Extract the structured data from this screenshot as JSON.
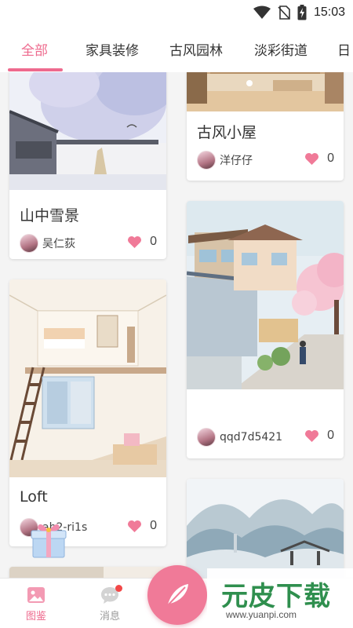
{
  "status_bar": {
    "time": "15:03",
    "icons": [
      "wifi-icon",
      "no-sim-icon",
      "battery-charging-icon"
    ]
  },
  "tabs": [
    {
      "label": "全部",
      "active": true
    },
    {
      "label": "家具装修",
      "active": false
    },
    {
      "label": "古风园林",
      "active": false
    },
    {
      "label": "淡彩街道",
      "active": false
    },
    {
      "label": "日",
      "active": false
    }
  ],
  "feed": {
    "cards": [
      {
        "title": "山中雪景",
        "author": "吴仁荻",
        "likes": "0",
        "image": "snowy-mountain-courtyard-illustration"
      },
      {
        "title": "古风小屋",
        "author": "洋仔仔",
        "likes": "0",
        "image": "wooden-room-interior-illustration"
      },
      {
        "title": "Loft",
        "author": "ah2-ri1s",
        "likes": "0",
        "image": "loft-interior-illustration"
      },
      {
        "title": "",
        "author": "qqd7d5421",
        "likes": "0",
        "image": "cherry-blossom-street-illustration"
      },
      {
        "title": "",
        "author": "",
        "likes": "",
        "image": "misty-mountain-pavilion-illustration"
      }
    ]
  },
  "bottom_nav": {
    "items": [
      {
        "label": "图鉴",
        "icon": "gallery-icon",
        "active": true
      },
      {
        "label": "消息",
        "icon": "chat-icon",
        "active": false,
        "badge": true
      }
    ],
    "fab_icon": "feather-icon"
  },
  "watermark": {
    "logo": "元皮下载",
    "url": "www.yuanpi.com"
  },
  "colors": {
    "accent": "#ee6a8e",
    "fab": "#f07a98",
    "badge": "#f24848",
    "watermark": "#2f8f4e"
  }
}
